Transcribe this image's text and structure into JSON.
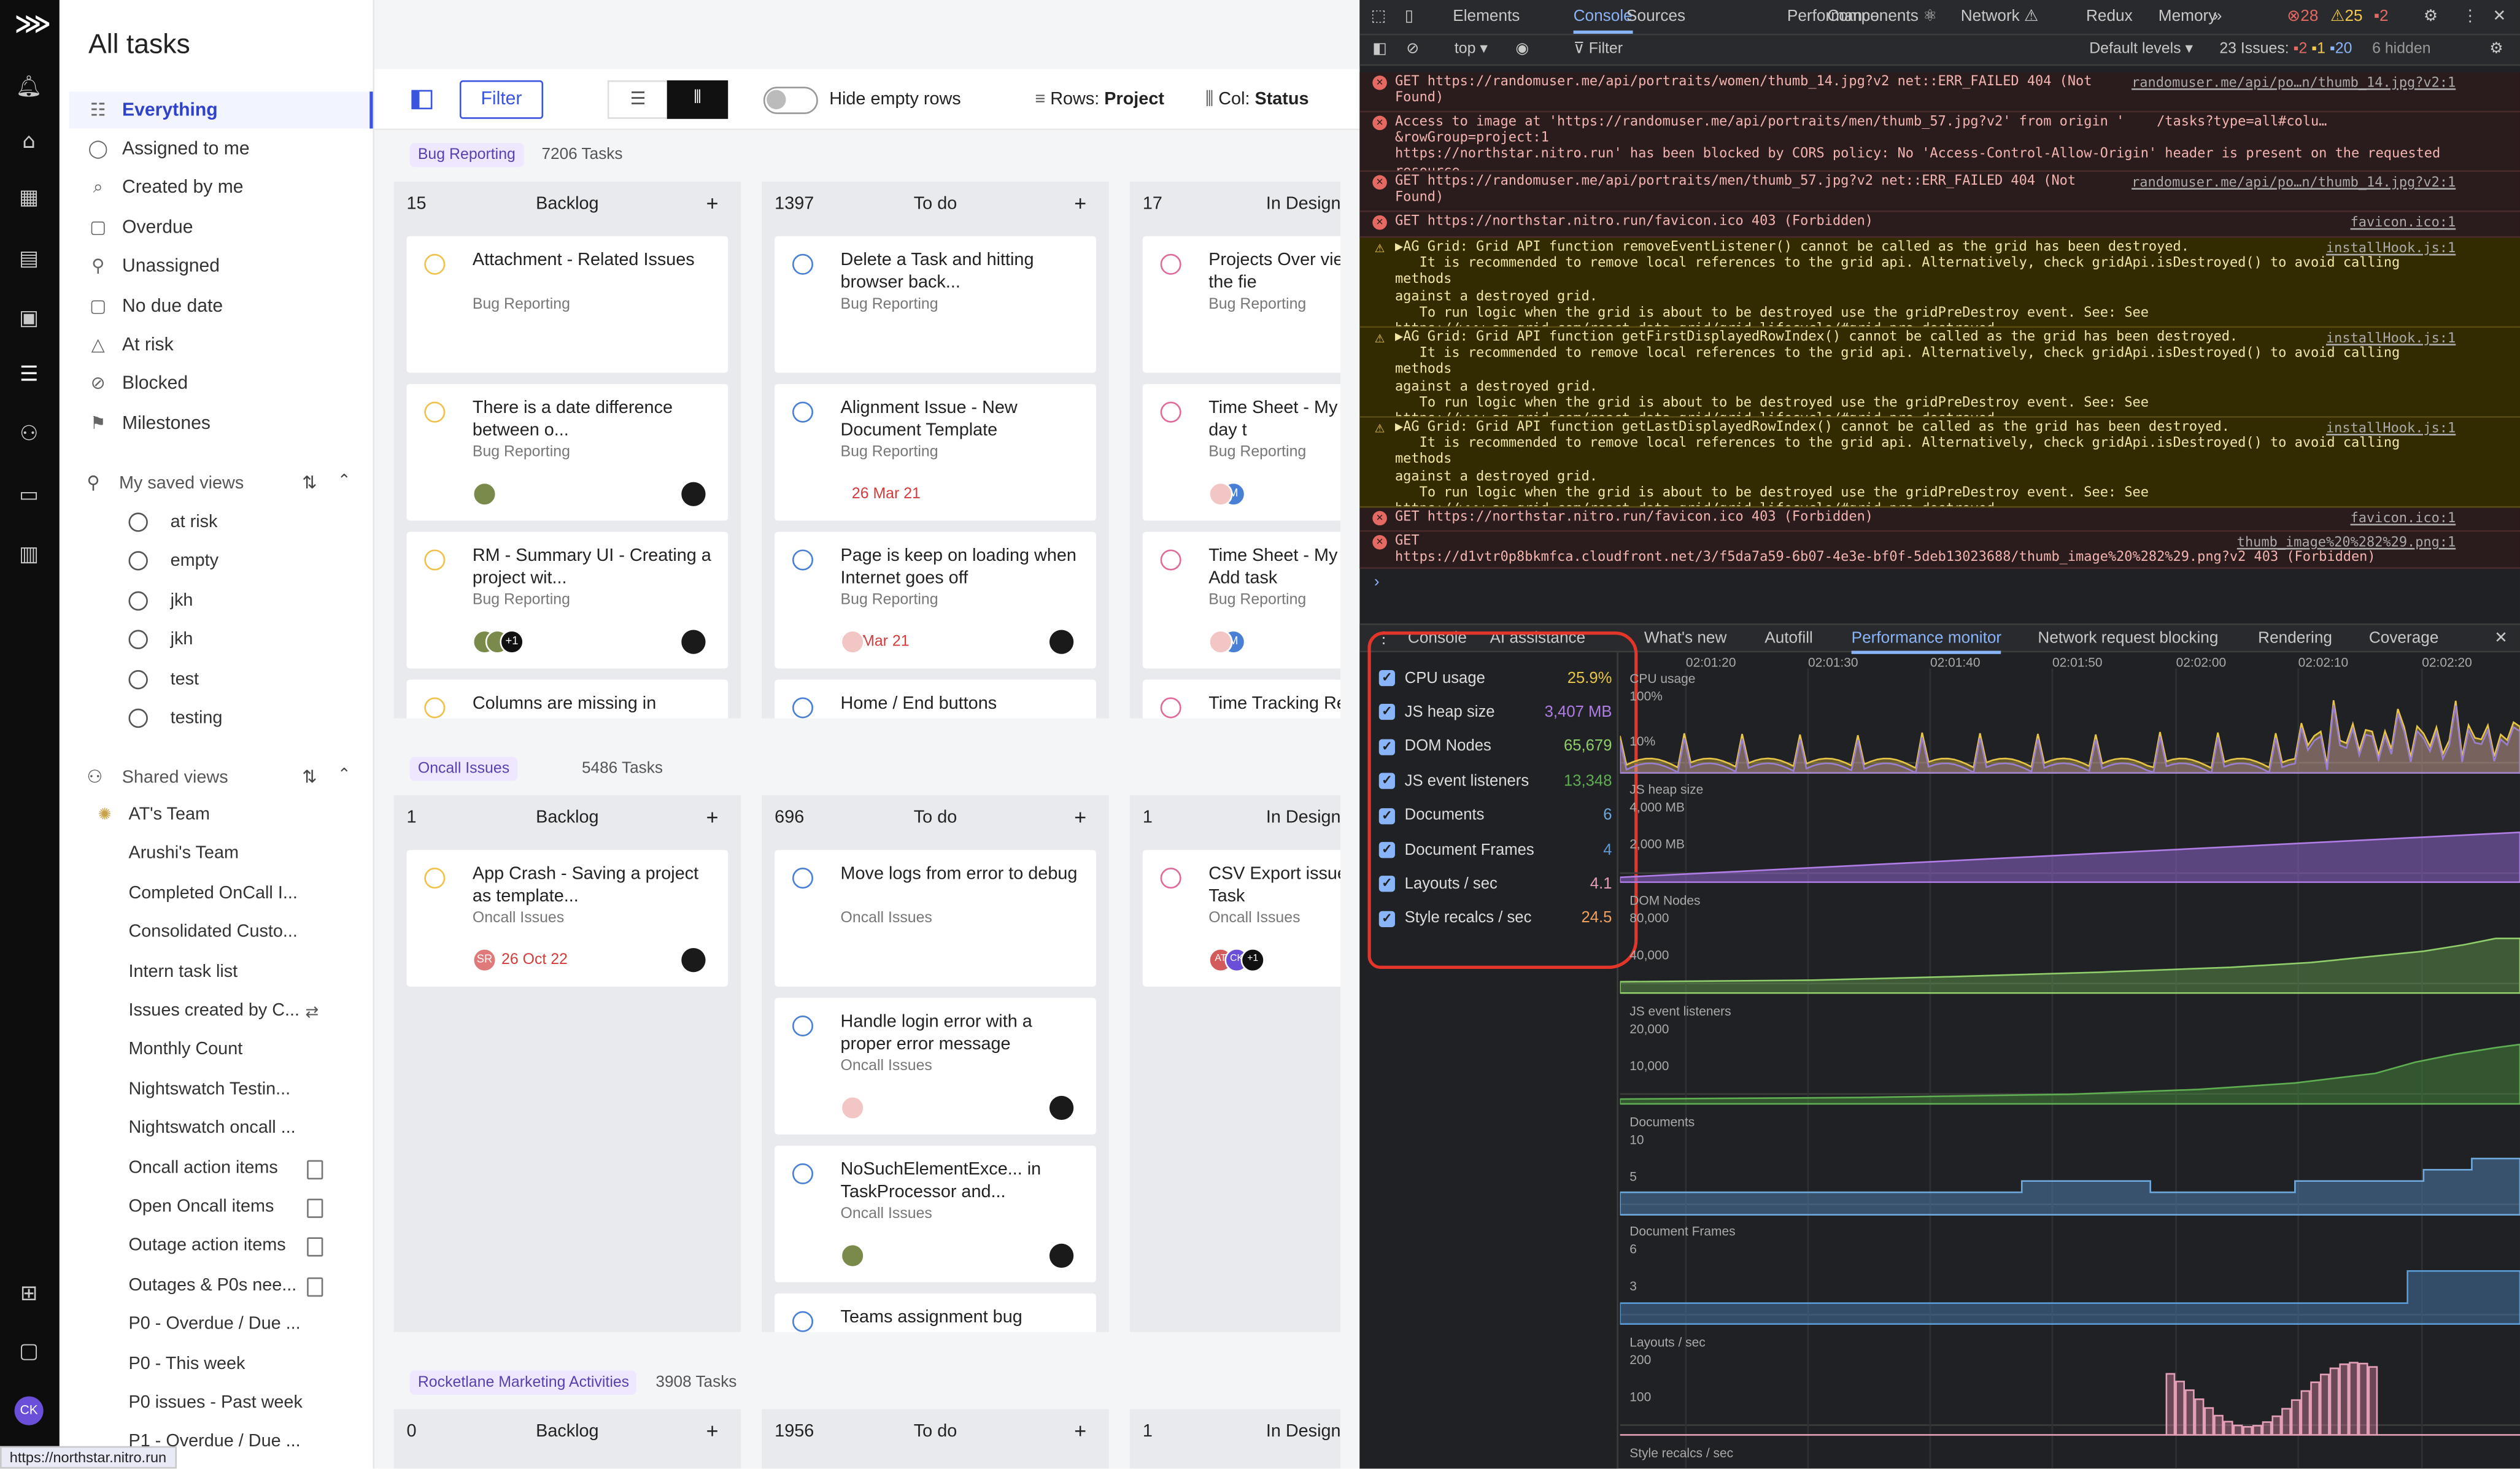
{
  "app": {
    "title": "All tasks",
    "user_initials": "CK",
    "status_url": "https://northstar.nitro.run"
  },
  "nav": {
    "items": [
      {
        "label": "Everything",
        "icon": "checklist-icon",
        "active": true
      },
      {
        "label": "Assigned to me",
        "icon": "user-circle-icon"
      },
      {
        "label": "Created by me",
        "icon": "search-icon"
      },
      {
        "label": "Overdue",
        "icon": "calendar-icon"
      },
      {
        "label": "Unassigned",
        "icon": "user-plus-icon"
      },
      {
        "label": "No due date",
        "icon": "calendar-icon"
      },
      {
        "label": "At risk",
        "icon": "warning-icon"
      },
      {
        "label": "Blocked",
        "icon": "blocked-icon"
      },
      {
        "label": "Milestones",
        "icon": "flag-icon"
      }
    ],
    "saved_views_title": "My saved views",
    "saved_views": [
      "at risk",
      "empty",
      "jkh",
      "jkh",
      "test",
      "testing"
    ],
    "shared_views_title": "Shared views",
    "shared_views": [
      "AT's Team",
      "Arushi's Team",
      "Completed OnCall I...",
      "Consolidated Custo...",
      "Intern task list",
      "Issues created by C...",
      "Monthly Count",
      "Nightswatch Testin...",
      "Nightswatch oncall ...",
      "Oncall action items",
      "Open Oncall items",
      "Outage action items",
      "Outages & P0s nee...",
      "P0 - Overdue / Due ...",
      "P0 - This week",
      "P0 issues - Past week",
      "P1 - Overdue / Due ..."
    ]
  },
  "toolbar": {
    "filter_label": "Filter",
    "hide_empty_label": "Hide empty rows",
    "rows_label": "Rows:",
    "rows_value": "Project",
    "col_label": "Col:",
    "col_value": "Status"
  },
  "groups": [
    {
      "name": "Bug Reporting",
      "count": "7206 Tasks",
      "columns": [
        {
          "count": "15",
          "name": "Backlog",
          "cards": [
            {
              "title": "Attachment - Related Issues",
              "project": "Bug Reporting",
              "date": ""
            },
            {
              "title": "There is a date difference between o...",
              "project": "Bug Reporting",
              "date": ""
            },
            {
              "title": "RM - Summary UI - Creating a project wit...",
              "project": "Bug Reporting",
              "date": "",
              "avatar_extra": "+1"
            },
            {
              "title": "Columns are missing in",
              "project": "",
              "date": ""
            }
          ]
        },
        {
          "count": "1397",
          "name": "To do",
          "cards": [
            {
              "title": "Delete a Task and hitting browser back...",
              "project": "Bug Reporting",
              "date": ""
            },
            {
              "title": "Alignment Issue - New Document Template",
              "project": "Bug Reporting",
              "date": "26 Mar 21"
            },
            {
              "title": "Page is keep on loading when Internet goes off",
              "project": "Bug Reporting",
              "date": "26 Mar 21"
            },
            {
              "title": "Home / End buttons",
              "project": "",
              "date": ""
            }
          ]
        },
        {
          "count": "17",
          "name": "In Design",
          "cards": [
            {
              "title": "Projects Over view Page - For the fie",
              "project": "Bug Reporting",
              "date": ""
            },
            {
              "title": "Time Sheet - My T Sheet - In a day t",
              "project": "Bug Reporting",
              "date": "",
              "avatar_letter": "M"
            },
            {
              "title": "Time Sheet - My T Sheet - Add task",
              "project": "Bug Reporting",
              "date": "",
              "avatar_letter": "M"
            },
            {
              "title": "Time Tracking Re",
              "project": "",
              "date": ""
            }
          ]
        }
      ]
    },
    {
      "name": "Oncall Issues",
      "count": "5486 Tasks",
      "columns": [
        {
          "count": "1",
          "name": "Backlog",
          "cards": [
            {
              "title": "App Crash - Saving a project as template...",
              "project": "Oncall Issues",
              "date": "26 Oct 22",
              "avatar_letter": "SR"
            }
          ]
        },
        {
          "count": "696",
          "name": "To do",
          "cards": [
            {
              "title": "Move logs from error to debug",
              "project": "Oncall Issues",
              "date": ""
            },
            {
              "title": "Handle login error with a proper error message",
              "project": "Oncall Issues",
              "date": ""
            },
            {
              "title": "NoSuchElementExce... in TaskProcessor and...",
              "project": "Oncall Issues",
              "date": ""
            },
            {
              "title": "Teams assignment bug",
              "project": "",
              "date": ""
            }
          ]
        },
        {
          "count": "1",
          "name": "In Design",
          "cards": [
            {
              "title": "CSV Export issue Project and Task",
              "project": "Oncall Issues",
              "date": "",
              "avatar_letters": [
                "AT",
                "CK",
                "+1"
              ]
            }
          ]
        }
      ]
    },
    {
      "name": "Rocketlane Marketing Activities",
      "count": "3908 Tasks",
      "columns": [
        {
          "count": "0",
          "name": "Backlog"
        },
        {
          "count": "1956",
          "name": "To do"
        },
        {
          "count": "1",
          "name": "In Design"
        }
      ]
    }
  ],
  "devtools": {
    "tabs": [
      "Elements",
      "Console",
      "Sources",
      "Performance",
      "Components ⚛",
      "Network ⚠",
      "Redux",
      "Memory",
      "»"
    ],
    "active_tab": "Console",
    "counts": {
      "errors": "28",
      "warnings": "25",
      "info": "2"
    },
    "context": "top",
    "filter_placeholder": "Filter",
    "levels": "Default levels",
    "issues": "23 Issues:",
    "issue_counts": [
      "2",
      "1",
      "20"
    ],
    "hidden": "6 hidden",
    "logs": [
      {
        "type": "err",
        "text": "GET https://randomuser.me/api/portraits/women/thumb_14.jpg?v2 net::ERR_FAILED 404 (Not\nFound)",
        "src": "randomuser.me/api/po…n/thumb_14.jpg?v2:1"
      },
      {
        "type": "err",
        "text": "Access to image at 'https://randomuser.me/api/portraits/men/thumb_57.jpg?v2' from origin '    /tasks?type=all#colu…&rowGroup=project:1\nhttps://northstar.nitro.run' has been blocked by CORS policy: No 'Access-Control-Allow-Origin' header is present on the requested\nresource.",
        "src": ""
      },
      {
        "type": "err",
        "text": "GET https://randomuser.me/api/portraits/men/thumb_57.jpg?v2 net::ERR_FAILED 404 (Not\nFound)",
        "src": "randomuser.me/api/po…n/thumb_14.jpg?v2:1"
      },
      {
        "type": "err",
        "text": "GET https://northstar.nitro.run/favicon.ico 403 (Forbidden)",
        "src": "favicon.ico:1"
      },
      {
        "type": "warn",
        "text": "▶AG Grid: Grid API function removeEventListener() cannot be called as the grid has been destroyed.\n   It is recommended to remove local references to the grid api. Alternatively, check gridApi.isDestroyed() to avoid calling methods\nagainst a destroyed grid.\n   To run logic when the grid is about to be destroyed use the gridPreDestroy event. See: See\nhttps://www.ag-grid.com/react-data-grid/grid-lifecycle/#grid-pre-destroyed",
        "src": "installHook.js:1"
      },
      {
        "type": "warn",
        "text": "▶AG Grid: Grid API function getFirstDisplayedRowIndex() cannot be called as the grid has been destroyed.\n   It is recommended to remove local references to the grid api. Alternatively, check gridApi.isDestroyed() to avoid calling methods\nagainst a destroyed grid.\n   To run logic when the grid is about to be destroyed use the gridPreDestroy event. See: See\nhttps://www.ag-grid.com/react-data-grid/grid-lifecycle/#grid-pre-destroyed",
        "src": "installHook.js:1"
      },
      {
        "type": "warn",
        "text": "▶AG Grid: Grid API function getLastDisplayedRowIndex() cannot be called as the grid has been destroyed.\n   It is recommended to remove local references to the grid api. Alternatively, check gridApi.isDestroyed() to avoid calling methods\nagainst a destroyed grid.\n   To run logic when the grid is about to be destroyed use the gridPreDestroy event. See: See\nhttps://www.ag-grid.com/react-data-grid/grid-lifecycle/#grid-pre-destroyed",
        "src": "installHook.js:1"
      },
      {
        "type": "err",
        "text": "GET https://northstar.nitro.run/favicon.ico 403 (Forbidden)",
        "src": "favicon.ico:1"
      },
      {
        "type": "err",
        "text": "GET\nhttps://d1vtr0p8bkmfca.cloudfront.net/3/f5da7a59-6b07-4e3e-bf0f-5deb13023688/thumb_image%20%282%29.png?v2 403 (Forbidden)",
        "src": "thumb_image%20%282%29.png:1"
      }
    ],
    "drawer_tabs": [
      "Console",
      "AI assistance",
      "What's new",
      "Autofill",
      "Performance monitor",
      "Network request blocking",
      "Rendering",
      "Coverage"
    ],
    "drawer_active": "Performance monitor",
    "metrics": [
      {
        "label": "CPU usage",
        "value": "25.9%",
        "color": "#e8c547"
      },
      {
        "label": "JS heap size",
        "value": "3,407 MB",
        "color": "#b07ce6"
      },
      {
        "label": "DOM Nodes",
        "value": "65,679",
        "color": "#8fce6a"
      },
      {
        "label": "JS event listeners",
        "value": "13,348",
        "color": "#5fae52"
      },
      {
        "label": "Documents",
        "value": "6",
        "color": "#6fa8dc"
      },
      {
        "label": "Document Frames",
        "value": "4",
        "color": "#5b9bd5"
      },
      {
        "label": "Layouts / sec",
        "value": "4.1",
        "color": "#e39fb5"
      },
      {
        "label": "Style recalcs / sec",
        "value": "24.5",
        "color": "#f0a060"
      }
    ],
    "time_ticks": [
      "02:01:20",
      "02:01:30",
      "02:01:40",
      "02:01:50",
      "02:02:00",
      "02:02:10",
      "02:02:20"
    ],
    "graphs": [
      {
        "title": "CPU usage",
        "scale": [
          "100%",
          "10%"
        ]
      },
      {
        "title": "JS heap size",
        "scale": [
          "4,000 MB",
          "2,000 MB"
        ]
      },
      {
        "title": "DOM Nodes",
        "scale": [
          "80,000",
          "40,000"
        ]
      },
      {
        "title": "JS event listeners",
        "scale": [
          "20,000",
          "10,000"
        ]
      },
      {
        "title": "Documents",
        "scale": [
          "10",
          "5"
        ]
      },
      {
        "title": "Document Frames",
        "scale": [
          "6",
          "3"
        ]
      },
      {
        "title": "Layouts / sec",
        "scale": [
          "200",
          "100"
        ]
      },
      {
        "title": "Style recalcs / sec",
        "scale": []
      }
    ]
  }
}
